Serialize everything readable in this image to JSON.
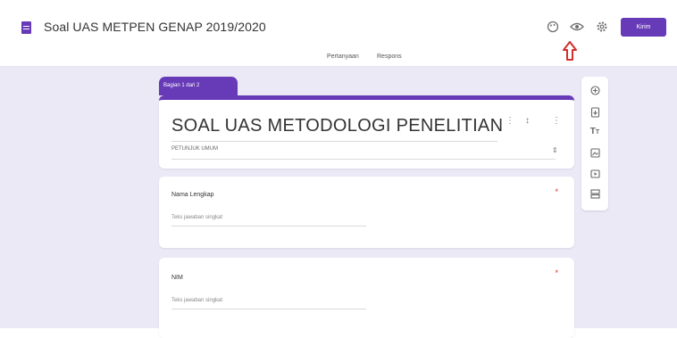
{
  "header": {
    "title": "Soal UAS METPEN GENAP 2019/2020",
    "send_label": "Kirim",
    "icons": [
      "palette-icon",
      "preview-eye-icon",
      "settings-gear-icon"
    ]
  },
  "tabs": [
    "Pertanyaan",
    "Respons"
  ],
  "section": {
    "label": "Bagian 1 dari 2"
  },
  "form": {
    "title": "SOAL UAS METODOLOGI PENELITIAN",
    "instructions": "PETUNJUK UMUM"
  },
  "questions": [
    {
      "label": "Nama Lengkap",
      "placeholder": "Teks jawaban singkat",
      "required_mark": "*"
    },
    {
      "label": "NIM",
      "placeholder": "Teks jawaban singkat",
      "required_mark": "*"
    }
  ],
  "colors": {
    "accent": "#673ab7",
    "canvas": "#ece9f6",
    "arrow": "#d32f2f",
    "required": "#d93025"
  }
}
